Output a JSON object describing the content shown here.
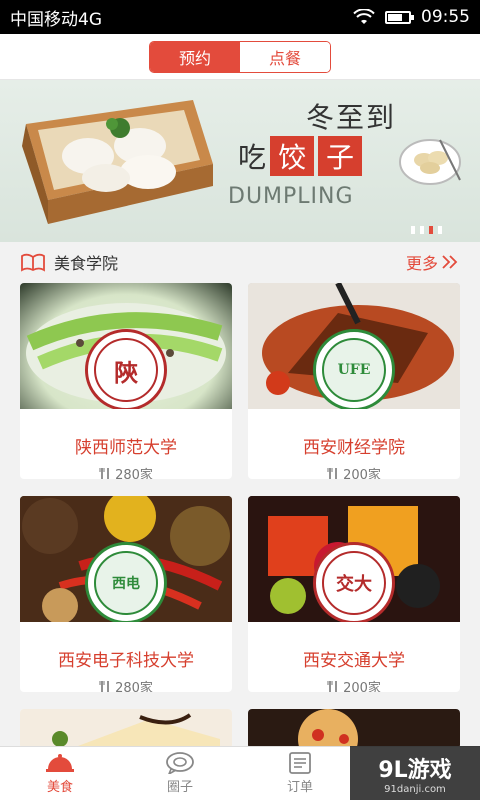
{
  "status_bar": {
    "carrier": "中国移动4G",
    "time": "09:55",
    "battery_level": 0.65
  },
  "tabs": [
    {
      "label": "预约",
      "active": true
    },
    {
      "label": "点餐",
      "active": false
    }
  ],
  "banner": {
    "headline": "冬至到",
    "sub_prefix": "吃",
    "sub_word_1": "饺",
    "sub_word_2": "子",
    "english": "DUMPLING",
    "page_count": 4,
    "active_page": 3
  },
  "section": {
    "title": "美食学院",
    "more": "更多"
  },
  "cards": [
    {
      "name": "陕西师范大学",
      "count": "280家",
      "seal": "陝"
    },
    {
      "name": "西安财经学院",
      "count": "200家",
      "seal": "UFE"
    },
    {
      "name": "西安电子科技大学",
      "count": "280家",
      "seal": "西电"
    },
    {
      "name": "西安交通大学",
      "count": "200家",
      "seal": "交大"
    }
  ],
  "bottom_nav": [
    {
      "label": "美食",
      "icon": "food-cover-icon",
      "active": true
    },
    {
      "label": "圈子",
      "icon": "circle-chat-icon",
      "active": false
    },
    {
      "label": "订单",
      "icon": "order-list-icon",
      "active": false
    }
  ],
  "watermark": {
    "logo": "9L游戏",
    "url": "91danji.com"
  },
  "colors": {
    "accent": "#e34b3c",
    "card_title": "#d63f2e"
  }
}
